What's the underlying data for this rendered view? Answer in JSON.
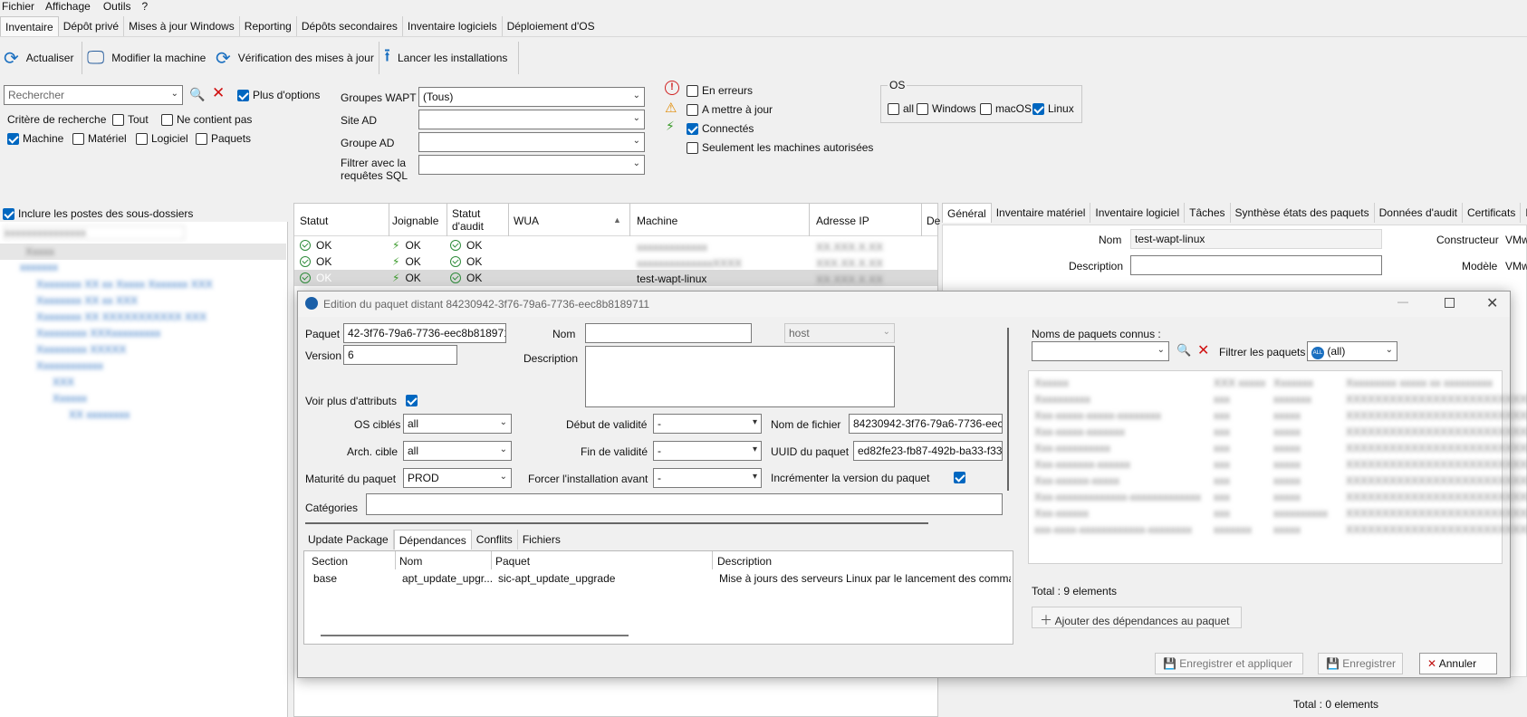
{
  "menu": [
    "Fichier",
    "Affichage",
    "Outils",
    "?"
  ],
  "main_tabs": [
    "Inventaire",
    "Dépôt privé",
    "Mises à jour Windows",
    "Reporting",
    "Dépôts secondaires",
    "Inventaire logiciels",
    "Déploiement d'OS"
  ],
  "toolbar": {
    "refresh": "Actualiser",
    "edit_machine": "Modifier la machine",
    "check_updates": "Vérification des mises à jour",
    "launch_installs": "Lancer les installations"
  },
  "filters": {
    "search_placeholder": "Rechercher",
    "more_options": "Plus d'options",
    "criteria_label": "Critère de recherche",
    "tout": "Tout",
    "ne_contient_pas": "Ne contient pas",
    "machine": "Machine",
    "materiel": "Matériel",
    "logiciel": "Logiciel",
    "paquets": "Paquets",
    "groupes_wapt_label": "Groupes WAPT",
    "groupes_wapt_value": "(Tous)",
    "site_ad_label": "Site AD",
    "groupe_ad_label": "Groupe AD",
    "sql_label_1": "Filtrer avec la",
    "sql_label_2": "requêtes SQL",
    "en_erreurs": "En erreurs",
    "a_mettre_a_jour": "A mettre à jour",
    "connectes": "Connectés",
    "seulement_autorisees": "Seulement les machines autorisées",
    "os_title": "OS",
    "os_all": "all",
    "os_windows": "Windows",
    "os_macos": "macOS",
    "os_linux": "Linux"
  },
  "left_panel": {
    "include_subfolders": "Inclure les postes des sous-dossiers",
    "tree_blurred": [
      "xxxxxxxxxxxxxxx",
      "Xxxxx",
      "xxxxxxx",
      "Xxxxxxxx XX xx Xxxxx Xxxxxxx XXX",
      "Xxxxxxxx XX xx XXX",
      "Xxxxxxxx XX XXXXXXXXXXX XXX",
      "Xxxxxxxxx XXXxxxxxxxxx",
      "Xxxxxxxxx XXXXX",
      "Xxxxxxxxxxxx",
      "XXX",
      "Xxxxxx",
      "XX xxxxxxxx"
    ]
  },
  "hosts_grid": {
    "columns": [
      "Statut",
      "Joignable",
      "Statut d'audit",
      "WUA",
      "Machine",
      "Adresse IP",
      "De"
    ],
    "rows": [
      {
        "statut": "OK",
        "joignable": "OK",
        "audit": "OK",
        "machine": "xxxxxxxxxxxxx",
        "ip": "XX.XXX.X.XX",
        "blur": true
      },
      {
        "statut": "OK",
        "joignable": "OK",
        "audit": "OK",
        "machine": "xxxxxxxxxxxxxxXXXX",
        "ip": "XXX.XX.X.XX",
        "blur": true
      },
      {
        "statut": "OK",
        "joignable": "OK",
        "audit": "OK",
        "machine": "test-wapt-linux",
        "ip": "XX.XXX.X.XX",
        "blur": false
      }
    ]
  },
  "right_panel": {
    "tabs": [
      "Général",
      "Inventaire matériel",
      "Inventaire logiciel",
      "Tâches",
      "Synthèse états des paquets",
      "Données d'audit",
      "Certificats",
      "D"
    ],
    "nom_label": "Nom",
    "nom_value": "test-wapt-linux",
    "description_label": "Description",
    "constructeur_label": "Constructeur",
    "constructeur_value": "VMw",
    "modele_label": "Modèle",
    "modele_value": "VMw",
    "total": "Total : 0 elements"
  },
  "dialog": {
    "title": "Edition du paquet distant 84230942-3f76-79a6-7736-eec8b8189711",
    "paquet_label": "Paquet",
    "paquet_value": "42-3f76-79a6-7736-eec8b8189711",
    "nom_label": "Nom",
    "nom_value": "",
    "host_value": "host",
    "version_label": "Version",
    "version_value": "6",
    "description_label": "Description",
    "voir_plus": "Voir plus d'attributs",
    "os_cibles_label": "OS ciblés",
    "os_cibles_value": "all",
    "debut_validite_label": "Début de validité",
    "debut_validite_value": "-",
    "nom_fichier_label": "Nom de fichier",
    "nom_fichier_value": "84230942-3f76-79a6-7736-eec8l",
    "arch_label": "Arch. cible",
    "arch_value": "all",
    "fin_validite_label": "Fin de validité",
    "fin_validite_value": "-",
    "uuid_label": "UUID du paquet",
    "uuid_value": "ed82fe23-fb87-492b-ba33-f33c",
    "maturite_label": "Maturité du paquet",
    "maturite_value": "PROD",
    "forcer_label": "Forcer l'installation avant",
    "forcer_value": "-",
    "incrementer_label": "Incrémenter la version du paquet",
    "categories_label": "Catégories",
    "bottom_tabs": [
      "Update Package",
      "Dépendances",
      "Conflits",
      "Fichiers"
    ],
    "dep_columns": [
      "Section",
      "Nom",
      "Paquet",
      "Description"
    ],
    "dep_rows": [
      {
        "section": "base",
        "nom": "apt_update_upgr...",
        "paquet": "sic-apt_update_upgrade",
        "description": "Mise à jours des serveurs Linux par le lancement des commar"
      }
    ],
    "known_label": "Noms de paquets connus :",
    "filter_label": "Filtrer les paquets",
    "filter_value": "(all)",
    "filter_badge": "ALL",
    "known_rows_blurred": [
      [
        "Xxxxxx",
        "XXX xxxxx",
        "Xxxxxxx",
        "Xxxxxxxxx xxxxx xx xxxxxxxxx"
      ],
      [
        "Xxxxxxxxxx",
        "xxx",
        "xxxxxxx",
        "XXXXXXXXXXXXXXXXXXXXXXXXXXXX"
      ],
      [
        "Xxx-xxxxx-xxxxx-xxxxxxxx",
        "xxx",
        "xxxxx",
        "XXXXXXXXXXXXXXXXXXXXXXXXXXXX"
      ],
      [
        "Xxx-xxxxx-xxxxxxx",
        "xxx",
        "xxxxx",
        "XXXXXXXXXXXXXXXXXXXXXXXXXXXX"
      ],
      [
        "Xxx-xxxxxxxxxx",
        "xxx",
        "xxxxx",
        "XXXXXXXXXXXXXXXXXXXXXXXXXXXX"
      ],
      [
        "Xxx-xxxxxxx-xxxxxx",
        "xxx",
        "xxxxx",
        "XXXXXXXXXXXXXXXXXXXXXXXXXXXX"
      ],
      [
        "Xxx-xxxxxx-xxxxx",
        "xxx",
        "xxxxx",
        "XXXXXXXXXXXXXXXXXXXXXXXXXXXX"
      ],
      [
        "Xxx-xxxxxxxxxxxxx-xxxxxxxxxxxxx",
        "xxx",
        "xxxxx",
        "XXXXXXXXXXXXXXXXXXXXXXXXXXXX"
      ],
      [
        "Xxx-xxxxxx",
        "xxx",
        "xxxxxxxxxx",
        "XXXXXXXXXXXXXXXXXXXXXXXXXXXX"
      ],
      [
        "xxx-xxxx-xxxxxxxxxxxx-xxxxxxxx",
        "xxxxxxx",
        "xxxxx",
        "XXXXXXXXXXXXXXXXXXXXXXXXXXXX"
      ]
    ],
    "total": "Total : 9 elements",
    "add_deps": "Ajouter des dépendances au paquet",
    "save_apply": "Enregistrer et appliquer",
    "save": "Enregistrer",
    "cancel": "Annuler"
  }
}
